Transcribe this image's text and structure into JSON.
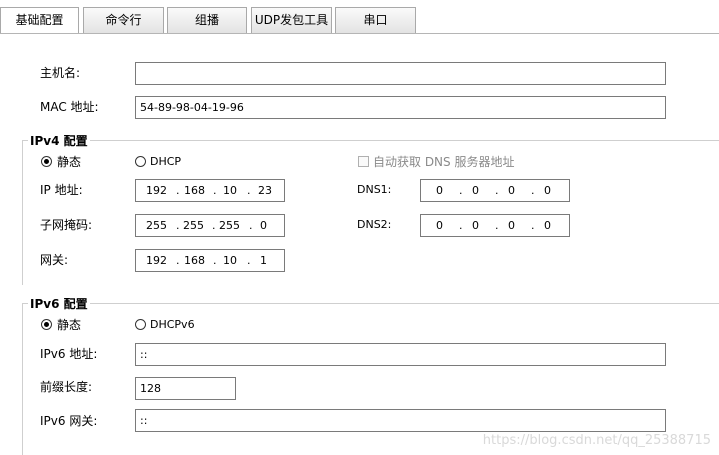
{
  "tabs": [
    {
      "label": "基础配置",
      "active": true
    },
    {
      "label": "命令行",
      "active": false
    },
    {
      "label": "组播",
      "active": false
    },
    {
      "label": "UDP发包工具",
      "active": false
    },
    {
      "label": "串口",
      "active": false
    }
  ],
  "general": {
    "hostname_label": "主机名:",
    "hostname_value": "",
    "mac_label": "MAC 地址:",
    "mac_value": "54-89-98-04-19-96"
  },
  "ipv4": {
    "legend": "IPv4 配置",
    "static_label": "静态",
    "dhcp_label": "DHCP",
    "auto_dns_label": "自动获取 DNS 服务器地址",
    "ip_label": "IP 地址:",
    "ip": [
      "192",
      "168",
      "10",
      "23"
    ],
    "mask_label": "子网掩码:",
    "mask": [
      "255",
      "255",
      "255",
      "0"
    ],
    "gateway_label": "网关:",
    "gateway": [
      "192",
      "168",
      "10",
      "1"
    ],
    "dns1_label": "DNS1:",
    "dns1": [
      "0",
      "0",
      "0",
      "0"
    ],
    "dns2_label": "DNS2:",
    "dns2": [
      "0",
      "0",
      "0",
      "0"
    ],
    "dot": "."
  },
  "ipv6": {
    "legend": "IPv6 配置",
    "static_label": "静态",
    "dhcp_label": "DHCPv6",
    "ip_label": "IPv6 地址:",
    "ip_value": "::",
    "prefix_label": "前缀长度:",
    "prefix_value": "128",
    "gateway_label": "IPv6 网关:",
    "gateway_value": "::"
  },
  "watermark": "https://blog.csdn.net/qq_25388715"
}
